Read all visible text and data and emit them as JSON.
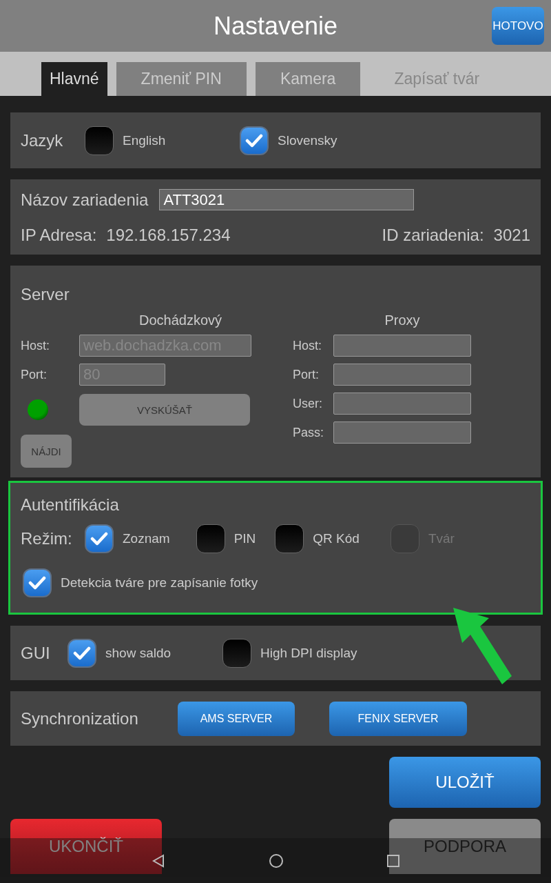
{
  "header": {
    "title": "Nastavenie",
    "done_button": "HOTOVO"
  },
  "tabs": [
    {
      "label": "Hlavné",
      "selected": true,
      "disabled": false
    },
    {
      "label": "Zmeniť PIN",
      "selected": false,
      "disabled": false
    },
    {
      "label": "Kamera",
      "selected": false,
      "disabled": false
    },
    {
      "label": "Zapísať tvár",
      "selected": false,
      "disabled": true
    }
  ],
  "language": {
    "label": "Jazyk",
    "options": [
      {
        "label": "English",
        "checked": false
      },
      {
        "label": "Slovensky",
        "checked": true
      }
    ]
  },
  "device": {
    "name_label": "Názov zariadenia",
    "name_value": "ATT3021",
    "ip_label": "IP Adresa:",
    "ip_value": "192.168.157.234",
    "id_label": "ID zariadenia:",
    "id_value": "3021"
  },
  "server": {
    "title": "Server",
    "attendance": {
      "heading": "Dochádzkový",
      "fields": [
        {
          "label": "Host:",
          "value": "web.dochadzka.com",
          "disabled": true
        },
        {
          "label": "Port:",
          "value": "80",
          "disabled": true
        }
      ],
      "test_button": "VYSKÚŠAŤ",
      "find_button": "NÁJDI"
    },
    "proxy": {
      "heading": "Proxy",
      "fields": [
        {
          "label": "Host:"
        },
        {
          "label": "Port:"
        },
        {
          "label": "User:"
        },
        {
          "label": "Pass:"
        }
      ]
    }
  },
  "auth": {
    "title": "Autentifikácia",
    "highlighted": true,
    "mode_label": "Režim:",
    "modes": [
      {
        "label": "Zoznam",
        "checked": true,
        "disabled": false
      },
      {
        "label": "PIN",
        "checked": false,
        "disabled": false
      },
      {
        "label": "QR Kód",
        "checked": false,
        "disabled": false
      },
      {
        "label": "Tvár",
        "checked": false,
        "disabled": true
      }
    ],
    "face_detection": {
      "label": "Detekcia tváre pre zapísanie fotky",
      "checked": true
    }
  },
  "gui": {
    "label": "GUI",
    "options": [
      {
        "label": "show saldo",
        "checked": true
      },
      {
        "label": "High DPI display",
        "checked": false
      }
    ]
  },
  "sync": {
    "label": "Synchronization",
    "buttons": [
      "AMS SERVER",
      "FENIX SERVER"
    ]
  },
  "save_button": "ULOŽIŤ",
  "exit_button": "UKONČIŤ",
  "support_button": "PODPORA"
}
